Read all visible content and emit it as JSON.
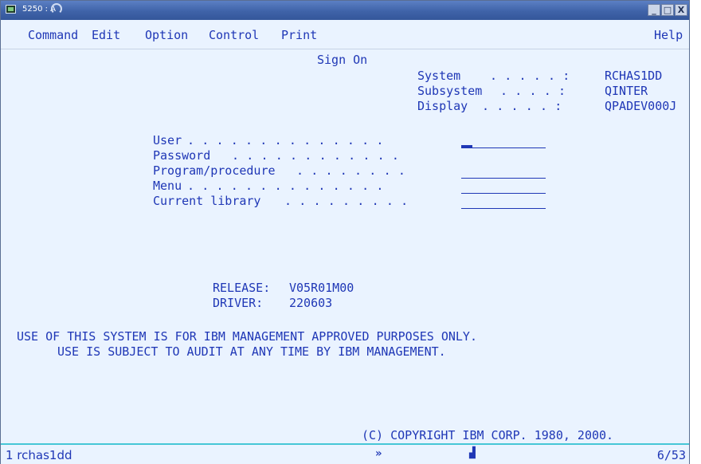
{
  "window": {
    "title": "5250 : A",
    "buttons": [
      "_",
      "□",
      "X"
    ]
  },
  "menu": {
    "left": [
      "Command",
      "Edit",
      "Option",
      "Control",
      "Print"
    ],
    "right": "Help"
  },
  "screen": {
    "heading": "Sign On",
    "system_info": [
      {
        "label": "System",
        "dots": ". . . . . :",
        "value": "RCHAS1DD"
      },
      {
        "label": "Subsystem",
        "dots": ". . . . :",
        "value": "QINTER"
      },
      {
        "label": "Display",
        "dots": ". . . . . :",
        "value": "QPADEV000J"
      }
    ],
    "fields": [
      {
        "label": "User",
        "dots": ". . . . . . . . . . . . . .",
        "value": ""
      },
      {
        "label": "Password",
        "dots": ". . . . . . . . . . . .",
        "value": ""
      },
      {
        "label": "Program/procedure",
        "dots": ". . . . . . . .",
        "value": ""
      },
      {
        "label": "Menu",
        "dots": ". . . . . . . . . . . . . .",
        "value": ""
      },
      {
        "label": "Current library",
        "dots": ". . . . . . . . .",
        "value": ""
      }
    ],
    "release_label": "RELEASE:",
    "release_value": "V05R01M00",
    "driver_label": "DRIVER:",
    "driver_value": "220603",
    "notice_line1": "USE OF THIS SYSTEM IS FOR IBM MANAGEMENT APPROVED PURPOSES ONLY.",
    "notice_line2": "USE IS SUBJECT TO AUDIT AT ANY TIME BY IBM MANAGEMENT.",
    "copyright": "(C) COPYRIGHT IBM CORP. 1980, 2000."
  },
  "status": {
    "session": "1 rchas1dd",
    "cursor_position": "6/53",
    "icons": [
      "forward-arrow-icon",
      "keyboard-lock-icon"
    ]
  },
  "colors": {
    "text": "#1f37b6",
    "background": "#eaf3ff",
    "titlebar": "#3f63a8",
    "status_border": "#46c6d6"
  }
}
